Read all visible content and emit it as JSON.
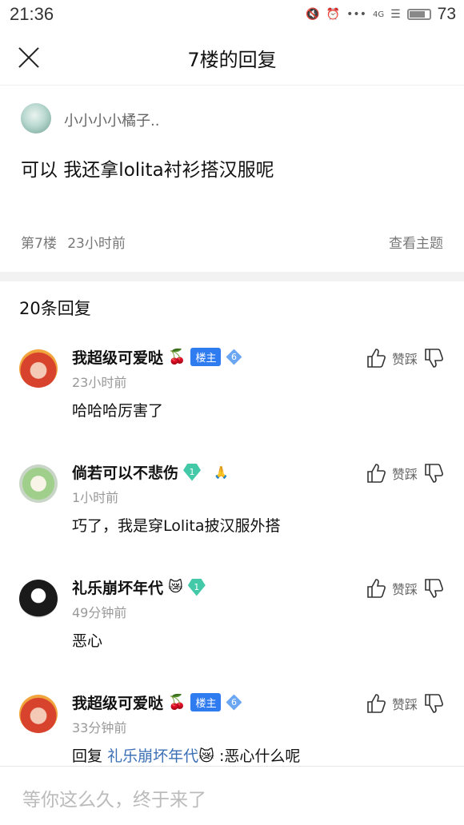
{
  "status_bar": {
    "time": "21:36",
    "network": "4G",
    "battery_level": 73,
    "battery_text": "73"
  },
  "nav": {
    "title": "7楼的回复",
    "close_icon": "close-icon"
  },
  "post": {
    "username": "小小小小橘子..",
    "content": "可以 我还拿lolita衬衫搭汉服呢",
    "floor": "第7楼",
    "time": "23小时前",
    "view_topic": "查看主题"
  },
  "replies": {
    "count_label": "20条回复",
    "action_label": "赞踩",
    "items": [
      {
        "name": "我超级可爱哒",
        "emoji": "🍒",
        "badge": "楼主",
        "level": "6",
        "time": "23小时前",
        "content": "哈哈哈厉害了"
      },
      {
        "name": "倘若可以不悲伤",
        "level": "1",
        "time": "1小时前",
        "content": "巧了，我是穿Lolita披汉服外搭"
      },
      {
        "name": "礼乐崩坏年代",
        "emoji": "😿",
        "level": "1",
        "time": "49分钟前",
        "content": "恶心"
      },
      {
        "name": "我超级可爱哒",
        "emoji": "🍒",
        "badge": "楼主",
        "level": "6",
        "time": "33分钟前",
        "reply_prefix": "回复",
        "reply_to": "礼乐崩坏年代",
        "reply_to_emoji": "😿",
        "content": ":恶心什么呢"
      }
    ]
  },
  "input": {
    "placeholder": "等你这么久，终于来了"
  },
  "colors": {
    "accent_blue": "#2f7bf0",
    "link_blue": "#3b6fb5",
    "level_green": "#43c9a8"
  }
}
